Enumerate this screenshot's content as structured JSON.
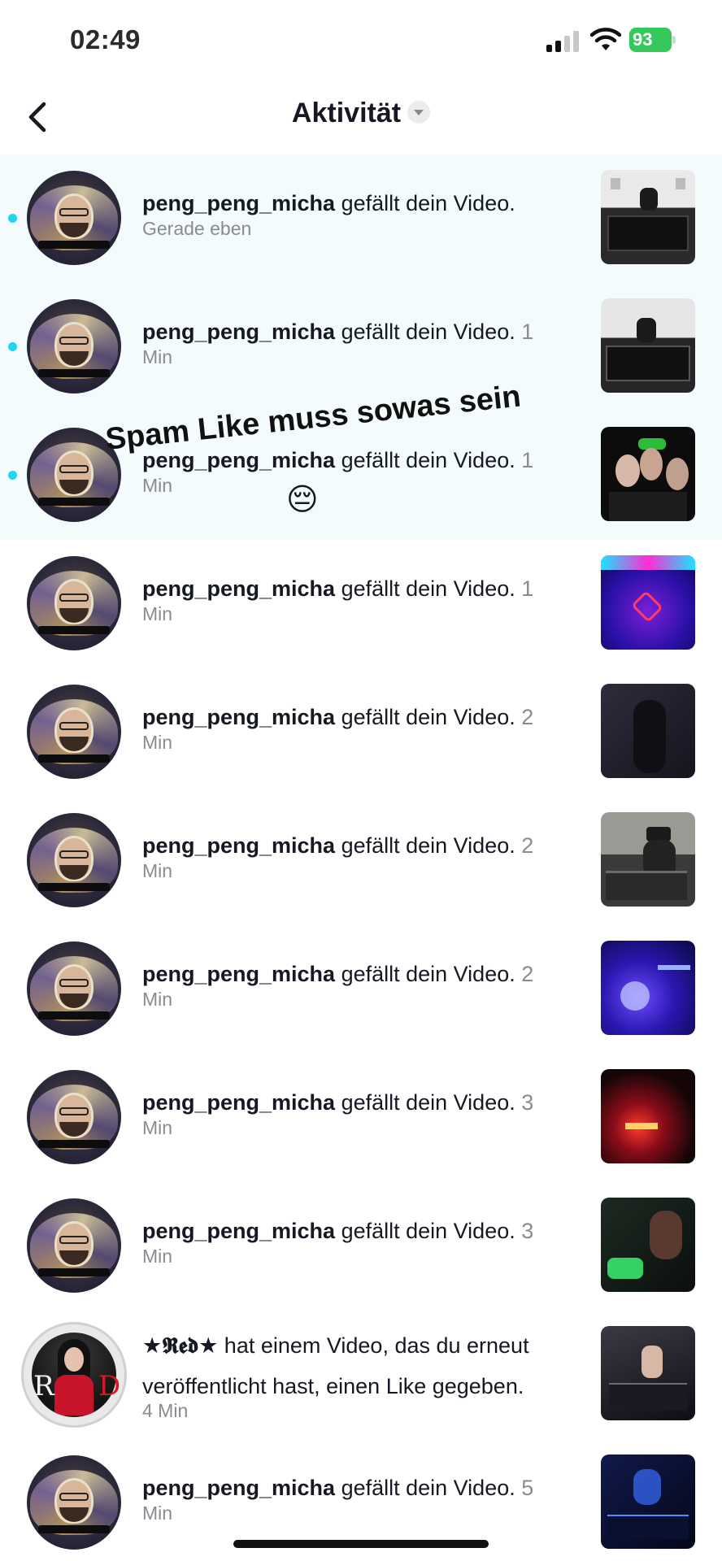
{
  "status_bar": {
    "time": "02:49",
    "battery": "93",
    "signal_icon": "cellular-signal-icon",
    "wifi_icon": "wifi-icon"
  },
  "header": {
    "title": "Aktivität",
    "back_icon": "chevron-left-icon",
    "dropdown_icon": "triangle-down-icon"
  },
  "notifications": [
    {
      "user": "peng_peng_micha",
      "action": " gefällt dein Video.",
      "time": "Gerade eben",
      "unread": true
    },
    {
      "user": "peng_peng_micha",
      "action": " gefällt dein Video.",
      "time_num": "1",
      "time": "Min",
      "unread": true
    },
    {
      "user": "peng_peng_micha",
      "action": " gefällt dein Video.",
      "time_num": "1",
      "time": "Min",
      "unread": true
    },
    {
      "user": "peng_peng_micha",
      "action": " gefällt dein Video.",
      "time_num": "1",
      "time": "Min",
      "unread": false
    },
    {
      "user": "peng_peng_micha",
      "action": " gefällt dein Video.",
      "time_num": "2",
      "time": "Min",
      "unread": false
    },
    {
      "user": "peng_peng_micha",
      "action": " gefällt dein Video.",
      "time_num": "2",
      "time": "Min",
      "unread": false
    },
    {
      "user": "peng_peng_micha",
      "action": " gefällt dein Video.",
      "time_num": "2",
      "time": "Min",
      "unread": false
    },
    {
      "user": "peng_peng_micha",
      "action": " gefällt dein Video.",
      "time_num": "3",
      "time": "Min",
      "unread": false
    },
    {
      "user": "peng_peng_micha",
      "action": " gefällt dein Video.",
      "time_num": "3",
      "time": "Min",
      "unread": false
    },
    {
      "user": "★𝕽𝖊𝖉★",
      "action": " hat einem Video, das du erneut veröffentlicht hast, einen Like gegeben.",
      "time": "4 Min",
      "unread": false
    },
    {
      "user": "peng_peng_micha",
      "action": " gefällt dein Video.",
      "time_num": "5",
      "time": "Min",
      "unread": false
    }
  ],
  "overlay": {
    "caption": "Spam Like muss sowas sein",
    "emoji": "😔"
  },
  "colors": {
    "unread_dot": "#20d5ec",
    "unread_bg": "#f4fbfd",
    "battery": "#34c759"
  }
}
